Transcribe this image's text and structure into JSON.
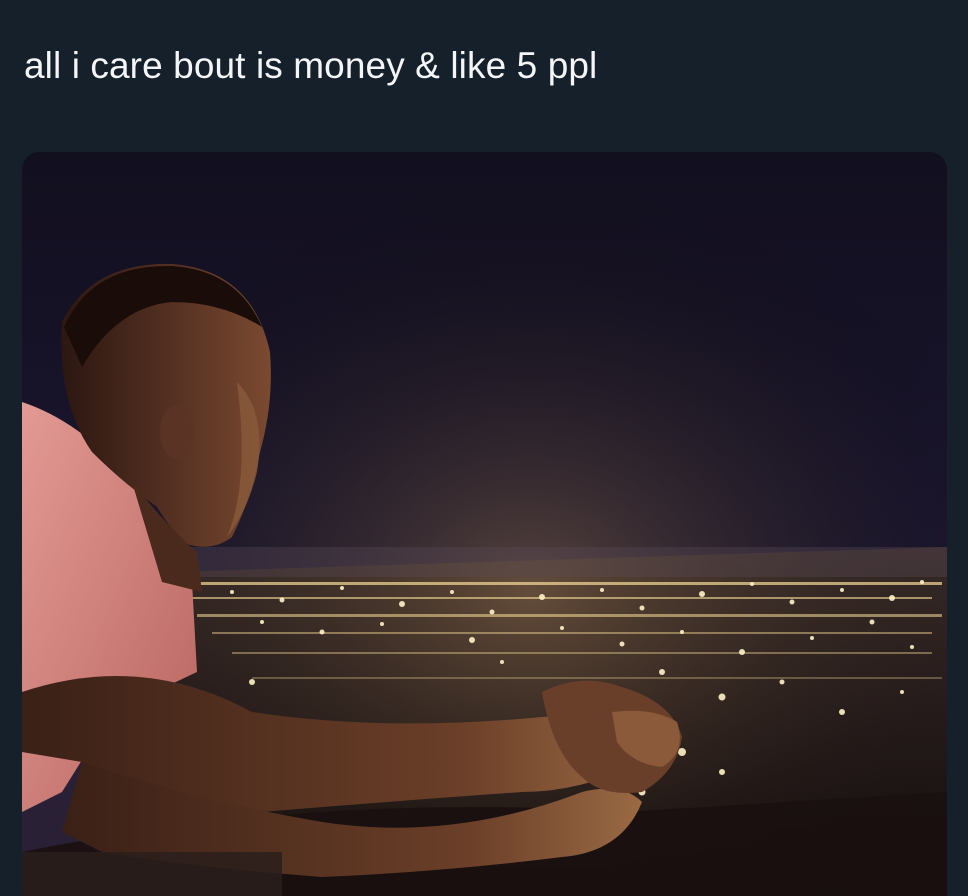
{
  "tweet": {
    "text": "all i care bout is money & like 5 ppl"
  },
  "media": {
    "kind": "photo",
    "colors": {
      "sky": "#17132a",
      "city_glow": "#f4d58a",
      "shirt": "#d98a86",
      "skin": "#4a2a1e",
      "background": "#15202b",
      "text": "#f3f5f7"
    }
  }
}
